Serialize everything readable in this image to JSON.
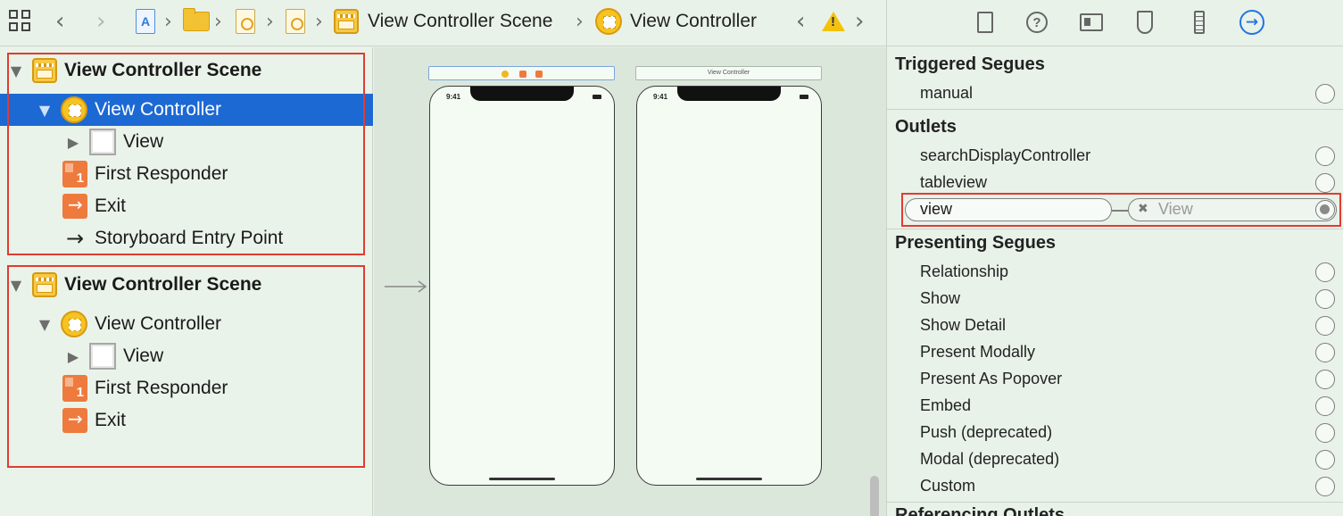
{
  "toolbar": {
    "breadcrumb": {
      "scene_label": "View Controller Scene",
      "controller_label": "View Controller"
    },
    "icons": [
      "grid-icon",
      "back-icon",
      "forward-icon",
      "project-icon",
      "folder-icon",
      "storyboard-file-icon",
      "storyboard-icon",
      "scene-icon",
      "view-controller-icon",
      "previous-issue-icon",
      "warning-icon",
      "next-issue-icon"
    ]
  },
  "outline": {
    "scenes": [
      {
        "title": "View Controller Scene",
        "controller": "View Controller",
        "view": "View",
        "first_responder": "First Responder",
        "exit": "Exit",
        "entry_point": "Storyboard Entry Point"
      },
      {
        "title": "View Controller Scene",
        "controller": "View Controller",
        "view": "View",
        "first_responder": "First Responder",
        "exit": "Exit"
      }
    ]
  },
  "canvas": {
    "scene2_bar_title": "View Controller",
    "phone1_time": "9:41",
    "phone2_time": "9:41"
  },
  "inspector": {
    "active_tab": "connections-inspector",
    "triggered_segues": {
      "header": "Triggered Segues",
      "items": [
        "manual"
      ]
    },
    "outlets": {
      "header": "Outlets",
      "items": [
        "searchDisplayController",
        "tableview"
      ],
      "connected": {
        "name": "view",
        "target": "View"
      }
    },
    "presenting_segues": {
      "header": "Presenting Segues",
      "items": [
        "Relationship",
        "Show",
        "Show Detail",
        "Present Modally",
        "Present As Popover",
        "Embed",
        "Push (deprecated)",
        "Modal (deprecated)",
        "Custom"
      ]
    },
    "next_header": "Referencing Outlets"
  },
  "colors": {
    "selection": "#1c69d3",
    "highlight_box": "#e03c31",
    "accent": "#1f74e8"
  }
}
